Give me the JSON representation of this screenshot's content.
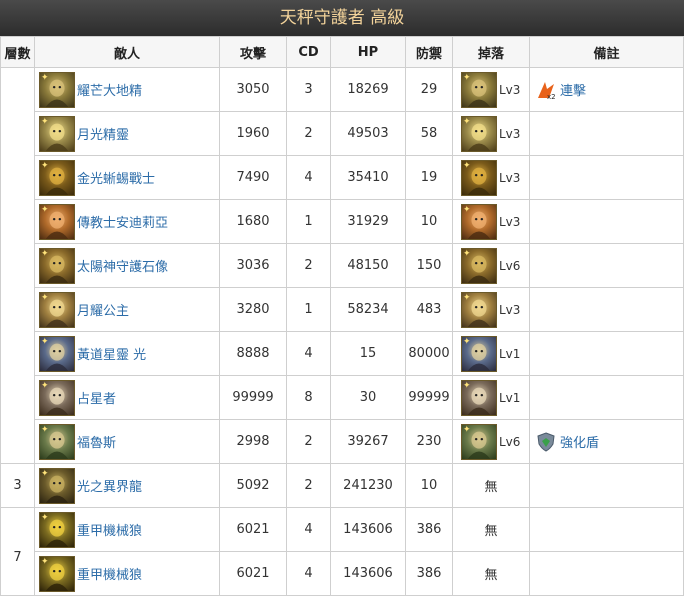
{
  "title": "天秤守護者 高級",
  "headers": [
    "層數",
    "敵人",
    "攻擊",
    "CD",
    "HP",
    "防禦",
    "掉落",
    "備註"
  ],
  "rows": [
    {
      "floor": "",
      "name": "耀芒大地精",
      "atk": "3050",
      "cd": "3",
      "hp": "18269",
      "def": "29",
      "drop": "Lv3",
      "note": "連擊",
      "icon": "goblin-portrait-icon",
      "attr": "light"
    },
    {
      "floor": "",
      "name": "月光精靈",
      "atk": "1960",
      "cd": "2",
      "hp": "49503",
      "def": "58",
      "drop": "Lv3",
      "note": "",
      "icon": "moon-spirit-portrait-icon",
      "attr": "light"
    },
    {
      "floor": "",
      "name": "金光蜥蜴戰士",
      "atk": "7490",
      "cd": "4",
      "hp": "35410",
      "def": "19",
      "drop": "Lv3",
      "note": "",
      "icon": "lizard-warrior-portrait-icon",
      "attr": "light"
    },
    {
      "floor": "",
      "name": "傳教士安迪莉亞",
      "atk": "1680",
      "cd": "1",
      "hp": "31929",
      "def": "10",
      "drop": "Lv3",
      "note": "",
      "icon": "missionary-portrait-icon",
      "attr": "light"
    },
    {
      "floor": "",
      "name": "太陽神守護石像",
      "atk": "3036",
      "cd": "2",
      "hp": "48150",
      "def": "150",
      "drop": "Lv6",
      "note": "",
      "icon": "sun-statue-portrait-icon",
      "attr": "light"
    },
    {
      "floor": "",
      "name": "月耀公主",
      "atk": "3280",
      "cd": "1",
      "hp": "58234",
      "def": "483",
      "drop": "Lv3",
      "note": "",
      "icon": "moon-princess-portrait-icon",
      "attr": "light"
    },
    {
      "floor": "",
      "name": "黃道星靈 光",
      "atk": "8888",
      "cd": "4",
      "hp": "15",
      "def": "80000",
      "drop": "Lv1",
      "note": "",
      "icon": "zodiac-spirit-portrait-icon",
      "attr": "light"
    },
    {
      "floor": "",
      "name": "占星者",
      "atk": "99999",
      "cd": "8",
      "hp": "30",
      "def": "99999",
      "drop": "Lv1",
      "note": "",
      "icon": "astrologer-portrait-icon",
      "attr": "light"
    },
    {
      "floor": "",
      "name": "福魯斯",
      "atk": "2998",
      "cd": "2",
      "hp": "39267",
      "def": "230",
      "drop": "Lv6",
      "note": "強化盾",
      "icon": "pholus-portrait-icon",
      "attr": "light"
    },
    {
      "floor": "3",
      "name": "光之異界龍",
      "atk": "5092",
      "cd": "2",
      "hp": "241230",
      "def": "10",
      "drop": "無",
      "note": "",
      "icon": "dragon-portrait-icon",
      "attr": "light"
    },
    {
      "floor": "7",
      "name": "重甲機械狼",
      "atk": "6021",
      "cd": "4",
      "hp": "143606",
      "def": "386",
      "drop": "無",
      "note": "",
      "icon": "mech-wolf-portrait-icon",
      "attr": "light"
    },
    {
      "floor": "",
      "name": "重甲機械狼",
      "atk": "6021",
      "cd": "4",
      "hp": "143606",
      "def": "386",
      "drop": "無",
      "note": "",
      "icon": "mech-wolf-portrait-icon",
      "attr": "light"
    }
  ],
  "colors": {
    "title_bg": "#333333",
    "title_text": "#f3d39a",
    "link": "#2c6ca8",
    "border": "#cfcfcf",
    "header_bg": "#f6f6f6"
  }
}
